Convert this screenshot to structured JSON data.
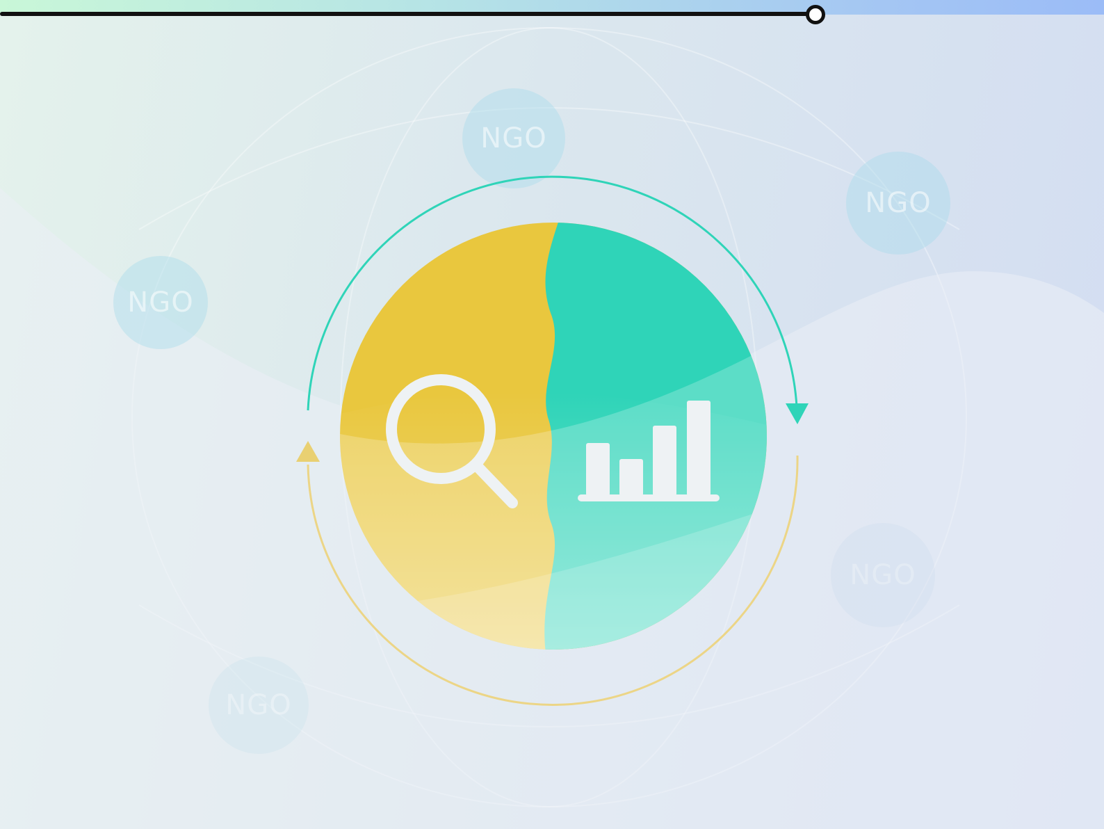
{
  "progress": {
    "fraction": 0.73
  },
  "colors": {
    "accent_teal": "#2fd4b8",
    "accent_yellow": "#e9c73e",
    "track": "#111111"
  },
  "bubbles": [
    {
      "label": "NGO"
    },
    {
      "label": "NGO"
    },
    {
      "label": "NGO"
    },
    {
      "label": "NGO"
    },
    {
      "label": "NGO"
    }
  ],
  "icons": {
    "search": "search-icon",
    "chart": "bar-chart-icon",
    "cycle": "cycle-arrows-icon"
  }
}
